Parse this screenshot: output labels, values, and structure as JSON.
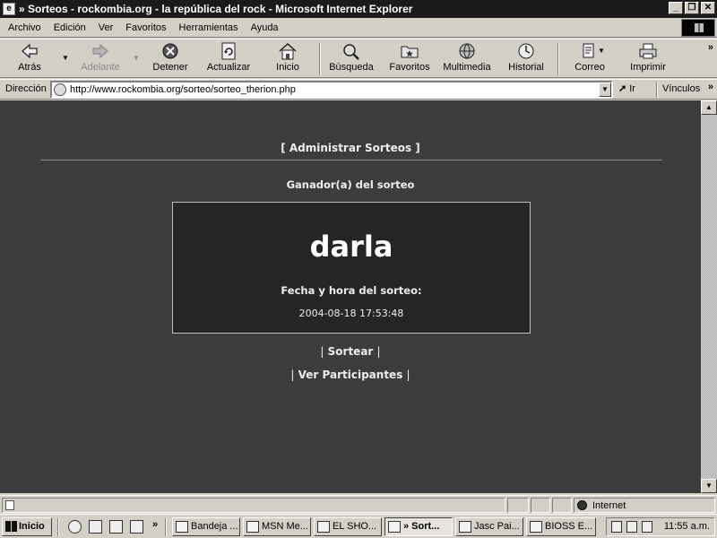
{
  "window": {
    "title": "» Sorteos - rockombia.org - la república del rock - Microsoft Internet Explorer",
    "minimize": "_",
    "maximize": "❐",
    "close": "✕"
  },
  "menu": [
    "Archivo",
    "Edición",
    "Ver",
    "Favoritos",
    "Herramientas",
    "Ayuda"
  ],
  "toolbar": {
    "back": "Atrás",
    "forward": "Adelante",
    "stop": "Detener",
    "refresh": "Actualizar",
    "home": "Inicio",
    "search": "Búsqueda",
    "favorites": "Favoritos",
    "media": "Multimedia",
    "history": "Historial",
    "mail": "Correo",
    "print": "Imprimir"
  },
  "address": {
    "label": "Dirección",
    "url": "http://www.rockombia.org/sorteo/sorteo_therion.php",
    "go": "Ir",
    "links": "Vínculos"
  },
  "page": {
    "admin_link": "[ Administrar Sorteos ]",
    "winner_heading": "Ganador(a) del sorteo",
    "winner_name": "darla",
    "draw_label": "Fecha y hora del sorteo:",
    "draw_datetime": "2004-08-18 17:53:48",
    "sortear": "Sortear",
    "ver_participantes": "Ver Participantes",
    "pipe": "|"
  },
  "status": {
    "zone": "Internet"
  },
  "taskbar": {
    "start": "Inicio",
    "tasks": [
      {
        "label": "Bandeja ...",
        "active": false
      },
      {
        "label": "MSN Me...",
        "active": false
      },
      {
        "label": "EL SHO...",
        "active": false
      },
      {
        "label": "» Sort...",
        "active": true
      },
      {
        "label": "Jasc Pai...",
        "active": false
      },
      {
        "label": "BIOSS E...",
        "active": false
      }
    ],
    "clock": "11:55 a.m."
  }
}
